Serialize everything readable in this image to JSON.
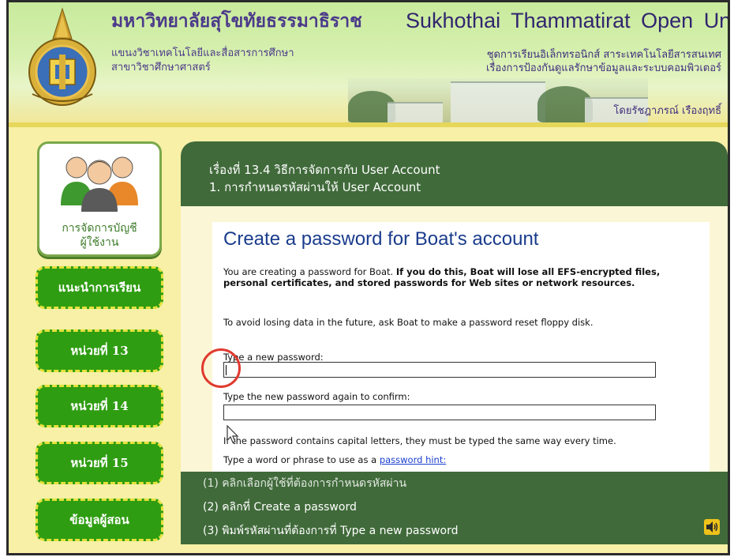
{
  "header": {
    "university_th": "มหาวิทยาลัยสุโขทัยธรรมาธิราช",
    "department_line1": "แขนงวิชาเทคโนโลยีและสื่อสารการศึกษา",
    "department_line2": "สาขาวิชาศึกษาศาสตร์",
    "university_en": "Sukhothai Thammatirat Open University",
    "course_line1": "ชุดการเรียนอิเล็กทรอนิกส์ สาระเทคโนโลยีสารสนเทศ",
    "course_line2": "เรื่องการป้องกันดูแลรักษาข้อมูลและระบบคอมพิวเตอร์",
    "author": "โดยรัชฎาภรณ์ เรืองฤทธิ์"
  },
  "sidebar": {
    "account_card_label_line1": "การจัดการบัญชี",
    "account_card_label_line2": "ผู้ใช้งาน",
    "buttons": [
      {
        "label": "แนะนำการเรียน"
      },
      {
        "label": "หน่วยที่ 13"
      },
      {
        "label": "หน่วยที่ 14"
      },
      {
        "label": "หน่วยที่ 15"
      },
      {
        "label": "ข้อมูลผู้สอน"
      }
    ]
  },
  "lesson": {
    "topic_line1": "เรื่องที่ 13.4 วิธีการจัดการกับ User Account",
    "topic_line2": "1. การกำหนดรหัสผ่านให้ User Account"
  },
  "dialog": {
    "title": "Create a password for Boat's account",
    "intro_plain": "You are creating a password for Boat. ",
    "intro_bold": "If you do this, Boat will lose all EFS-encrypted files, personal certificates, and stored passwords for Web sites or network resources.",
    "advice": "To avoid losing data in the future, ask Boat to make a password reset floppy disk.",
    "new_password_label": "Type a new password:",
    "new_password_value": "",
    "confirm_label": "Type the new password again to confirm:",
    "confirm_value": "",
    "caps_note": "If the password contains capital letters, they must be typed the same way every time.",
    "hint_prefix": "Type a word or phrase to use as a ",
    "hint_link": "password hint:"
  },
  "steps": [
    "(1) คลิกเลือกผู้ใช้ที่ต้องการกำหนดรหัสผ่าน",
    "(2) คลิกที่ Create a password",
    "(3) พิมพ์รหัสผ่านที่ต้องการที่ Type a new password"
  ],
  "colors": {
    "panel_green": "#406a3a",
    "button_green": "#2f9d12",
    "dialog_title_blue": "#1a3c8c",
    "highlight_red": "#e03a2f",
    "background_yellow": "#f7f0a6"
  }
}
